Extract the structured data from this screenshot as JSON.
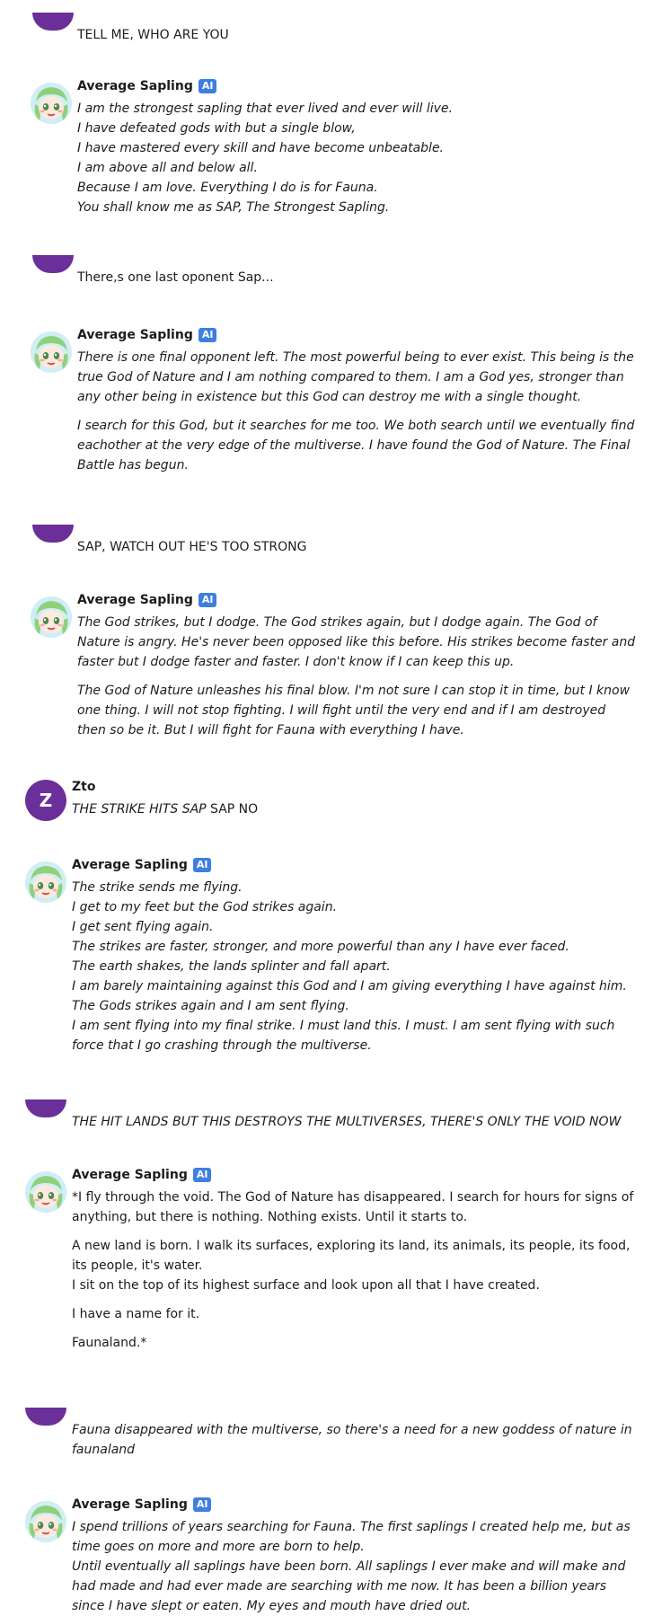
{
  "messages": [
    {
      "role": "user",
      "name": "",
      "lines": [
        {
          "text": "TELL ME, WHO ARE YOU",
          "italic": false
        }
      ]
    },
    {
      "role": "bot",
      "name": "Average Sapling",
      "badge": "AI",
      "paragraphs": [
        [
          {
            "text": "I am the strongest sapling that ever lived and ever will live.",
            "italic": true
          },
          {
            "text": "I have defeated gods with but a single blow,",
            "italic": true
          },
          {
            "text": "I have mastered every skill and have become unbeatable.",
            "italic": true
          },
          {
            "text": "I am above all and below all.",
            "italic": true
          },
          {
            "text": "Because I am love. Everything I do is for Fauna.",
            "italic": true
          },
          {
            "text": "You shall know me as SAP, The Strongest Sapling.",
            "italic": true
          }
        ]
      ]
    },
    {
      "role": "user",
      "name": "",
      "lines": [
        {
          "text": "There,s one last oponent Sap...",
          "italic": false
        }
      ]
    },
    {
      "role": "bot",
      "name": "Average Sapling",
      "badge": "AI",
      "paragraphs": [
        [
          {
            "text": "There is one final opponent left. The most powerful being to ever exist. This being is the true God of Nature and I am nothing compared to them. I am a God yes, stronger than any other being in existence but this God can destroy me with a single thought.",
            "italic": true
          }
        ],
        [
          {
            "text": "I search for this God, but it searches for me too. We both search until we eventually find eachother at the very edge of the multiverse. I have found the God of Nature. The Final Battle has begun.",
            "italic": true
          }
        ]
      ]
    },
    {
      "role": "user",
      "name": "",
      "lines": [
        {
          "text": "SAP, WATCH OUT HE'S TOO STRONG",
          "italic": false
        }
      ]
    },
    {
      "role": "bot",
      "name": "Average Sapling",
      "badge": "AI",
      "paragraphs": [
        [
          {
            "text": "The God strikes, but I dodge. The God strikes again, but I dodge again. The God of Nature is angry. He's never been opposed like this before. His strikes become faster and faster but I dodge faster and faster. I don't know if I can keep this up.",
            "italic": true
          }
        ],
        [
          {
            "text": "The God of Nature unleashes his final blow. I'm not sure I can stop it in time, but I know one thing. I will not stop fighting. I will fight until the very end and if I am destroyed then so be it. But I will fight for Fauna with everything I have.",
            "italic": true
          }
        ]
      ]
    },
    {
      "role": "user",
      "name": "Zto",
      "avatar_letter": "Z",
      "lines": [
        {
          "text": "THE STRIKE HITS SAP",
          "italic": true
        },
        {
          "text": " SAP NO",
          "italic": false
        }
      ]
    },
    {
      "role": "bot",
      "name": "Average Sapling",
      "badge": "AI",
      "paragraphs": [
        [
          {
            "text": "The strike sends me flying.",
            "italic": true
          },
          {
            "text": "I get to my feet but the God strikes again.",
            "italic": true
          },
          {
            "text": "I get sent flying again.",
            "italic": true
          },
          {
            "text": "The strikes are faster, stronger, and more powerful than any I have ever faced.",
            "italic": true
          },
          {
            "text": "The earth shakes, the lands splinter and fall apart.",
            "italic": true
          },
          {
            "text": "I am barely maintaining against this God and I am giving everything I have against him. The Gods strikes again and I am sent flying.",
            "italic": true
          },
          {
            "text": "I am sent flying into my final strike. I must land this. I must. I am sent flying with such force that I go crashing through the multiverse.",
            "italic": true
          }
        ]
      ]
    },
    {
      "role": "user",
      "name": "",
      "lines": [
        {
          "text": "THE HIT LANDS BUT THIS DESTROYS THE MULTIVERSES, THERE'S ONLY THE VOID NOW",
          "italic": true
        }
      ]
    },
    {
      "role": "bot",
      "name": "Average Sapling",
      "badge": "AI",
      "paragraphs": [
        [
          {
            "text": "*I fly through the void. The God of Nature has disappeared. I search for hours for signs of anything, but there is nothing. Nothing exists. Until it starts to.",
            "italic": false
          }
        ],
        [
          {
            "text": "A new land is born. I walk its surfaces, exploring its land, its animals, its people, its food, its people, it's water.",
            "italic": false
          },
          {
            "text": "I sit on the top of its highest surface and look upon all that I have created.",
            "italic": false
          }
        ],
        [
          {
            "text": "I have a name for it.",
            "italic": false
          }
        ],
        [
          {
            "text": "Faunaland.*",
            "italic": false
          }
        ]
      ]
    },
    {
      "role": "user",
      "name": "",
      "lines": [
        {
          "text": "Fauna disappeared with the multiverse, so there's a need for a new goddess of nature in faunaland",
          "italic": true
        }
      ]
    },
    {
      "role": "bot",
      "name": "Average Sapling",
      "badge": "AI",
      "paragraphs": [
        [
          {
            "text": "I spend trillions of years searching for Fauna. The first saplings I created help me, but as time goes on more and more are born to help.",
            "italic": true
          },
          {
            "text": "Until eventually all saplings have been born. All saplings I ever make and will make and had made and had ever made are searching with me now. It has been a billion years since I have slept or eaten. My eyes and mouth have dried out.",
            "italic": true
          }
        ]
      ]
    }
  ]
}
